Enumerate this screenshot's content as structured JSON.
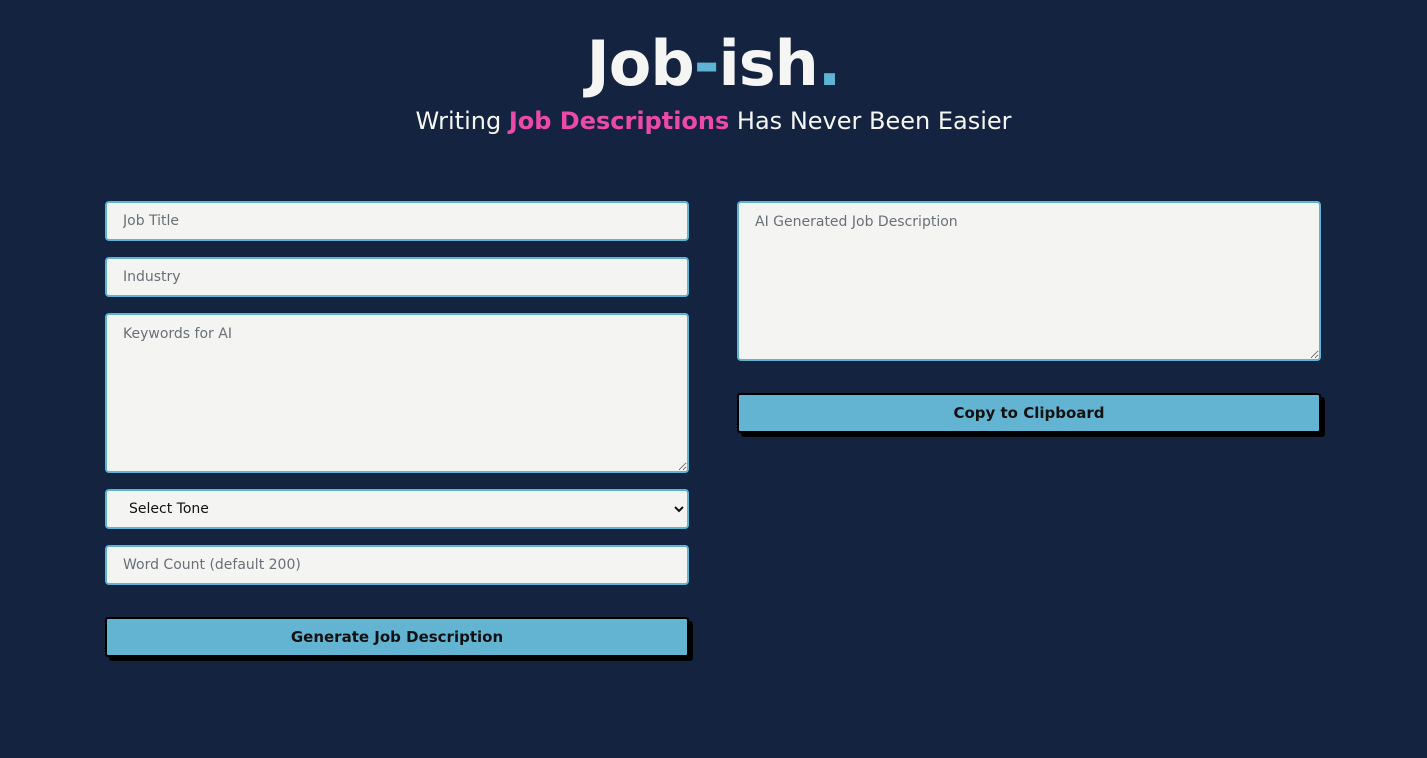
{
  "brand": {
    "logo_part1": "Job",
    "logo_dash": "-",
    "logo_part2": "ish",
    "logo_dot": "."
  },
  "tagline": {
    "prefix": "Writing ",
    "highlight": "Job Descriptions",
    "suffix": " Has Never Been Easier"
  },
  "form": {
    "job_title_placeholder": "Job Title",
    "industry_placeholder": "Industry",
    "keywords_placeholder": "Keywords for AI",
    "tone_selected": "Select Tone",
    "word_count_placeholder": "Word Count (default 200)",
    "generate_label": "Generate Job Description"
  },
  "output": {
    "description_placeholder": "AI Generated Job Description",
    "copy_label": "Copy to Clipboard"
  },
  "colors": {
    "background": "#14233f",
    "accent_blue": "#5fb3d3",
    "accent_pink": "#ec4aaa",
    "field_bg": "#f4f4f2",
    "button_bg": "#62b4d2"
  }
}
